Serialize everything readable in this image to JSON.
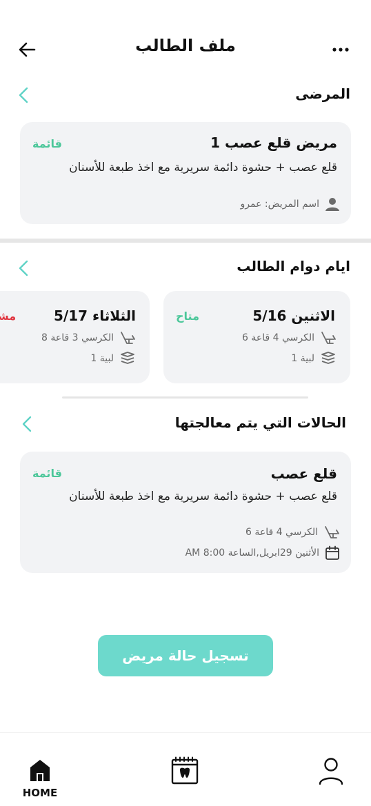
{
  "header": {
    "title": "ملف الطالب"
  },
  "patients_section": {
    "title": "المرضى",
    "card": {
      "title": "مريض قلع عصب 1",
      "status": "قائمة",
      "description": "قلع عصب + حشوة دائمة سريرية مع اخذ طبعة للأسنان",
      "patient_name": "اسم المريض: عمرو"
    }
  },
  "schedule_section": {
    "title": "ايام دوام الطالب",
    "days": [
      {
        "day": "الاثنين 5/16",
        "status": "متاح",
        "chair": "الكرسي 4 قاعة 6",
        "room": "لبية 1"
      },
      {
        "day": "الثلاثاء 5/17",
        "status": "مشغول",
        "chair": "الكرسي 3 قاعة 8",
        "room": "لبية 1"
      }
    ]
  },
  "cases_section": {
    "title": "الحالات التي يتم معالجتها",
    "card": {
      "title": "قلع عصب",
      "status": "قائمة",
      "description": "قلع عصب + حشوة دائمة سريرية مع اخذ طبعة للأسنان",
      "chair": "الكرسي 4 قاعة 6",
      "datetime": "الأثنين 29ابريل,الساعة AM 8:00"
    }
  },
  "cta": {
    "label": "تسجيل حالة مريض"
  },
  "bottom_nav": {
    "home_label": "HOME"
  },
  "colors": {
    "accent": "#5fd3c6",
    "green": "#4cc79a",
    "red": "#e0343f",
    "cta": "#6dd9cc"
  }
}
